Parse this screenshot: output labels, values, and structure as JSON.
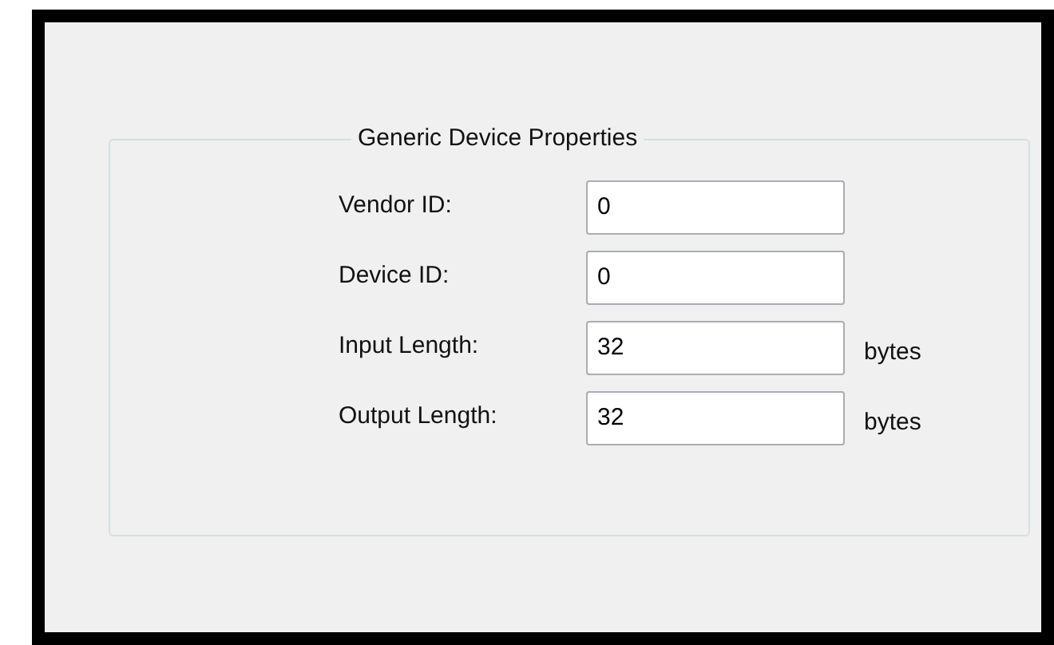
{
  "group": {
    "title": "Generic Device Properties",
    "fields": [
      {
        "label": "Vendor ID:",
        "value": "0"
      },
      {
        "label": "Device ID:",
        "value": "0"
      },
      {
        "label": "Input Length:",
        "value": "32",
        "unit": "bytes"
      },
      {
        "label": "Output Length:",
        "value": "32",
        "unit": "bytes"
      }
    ]
  }
}
